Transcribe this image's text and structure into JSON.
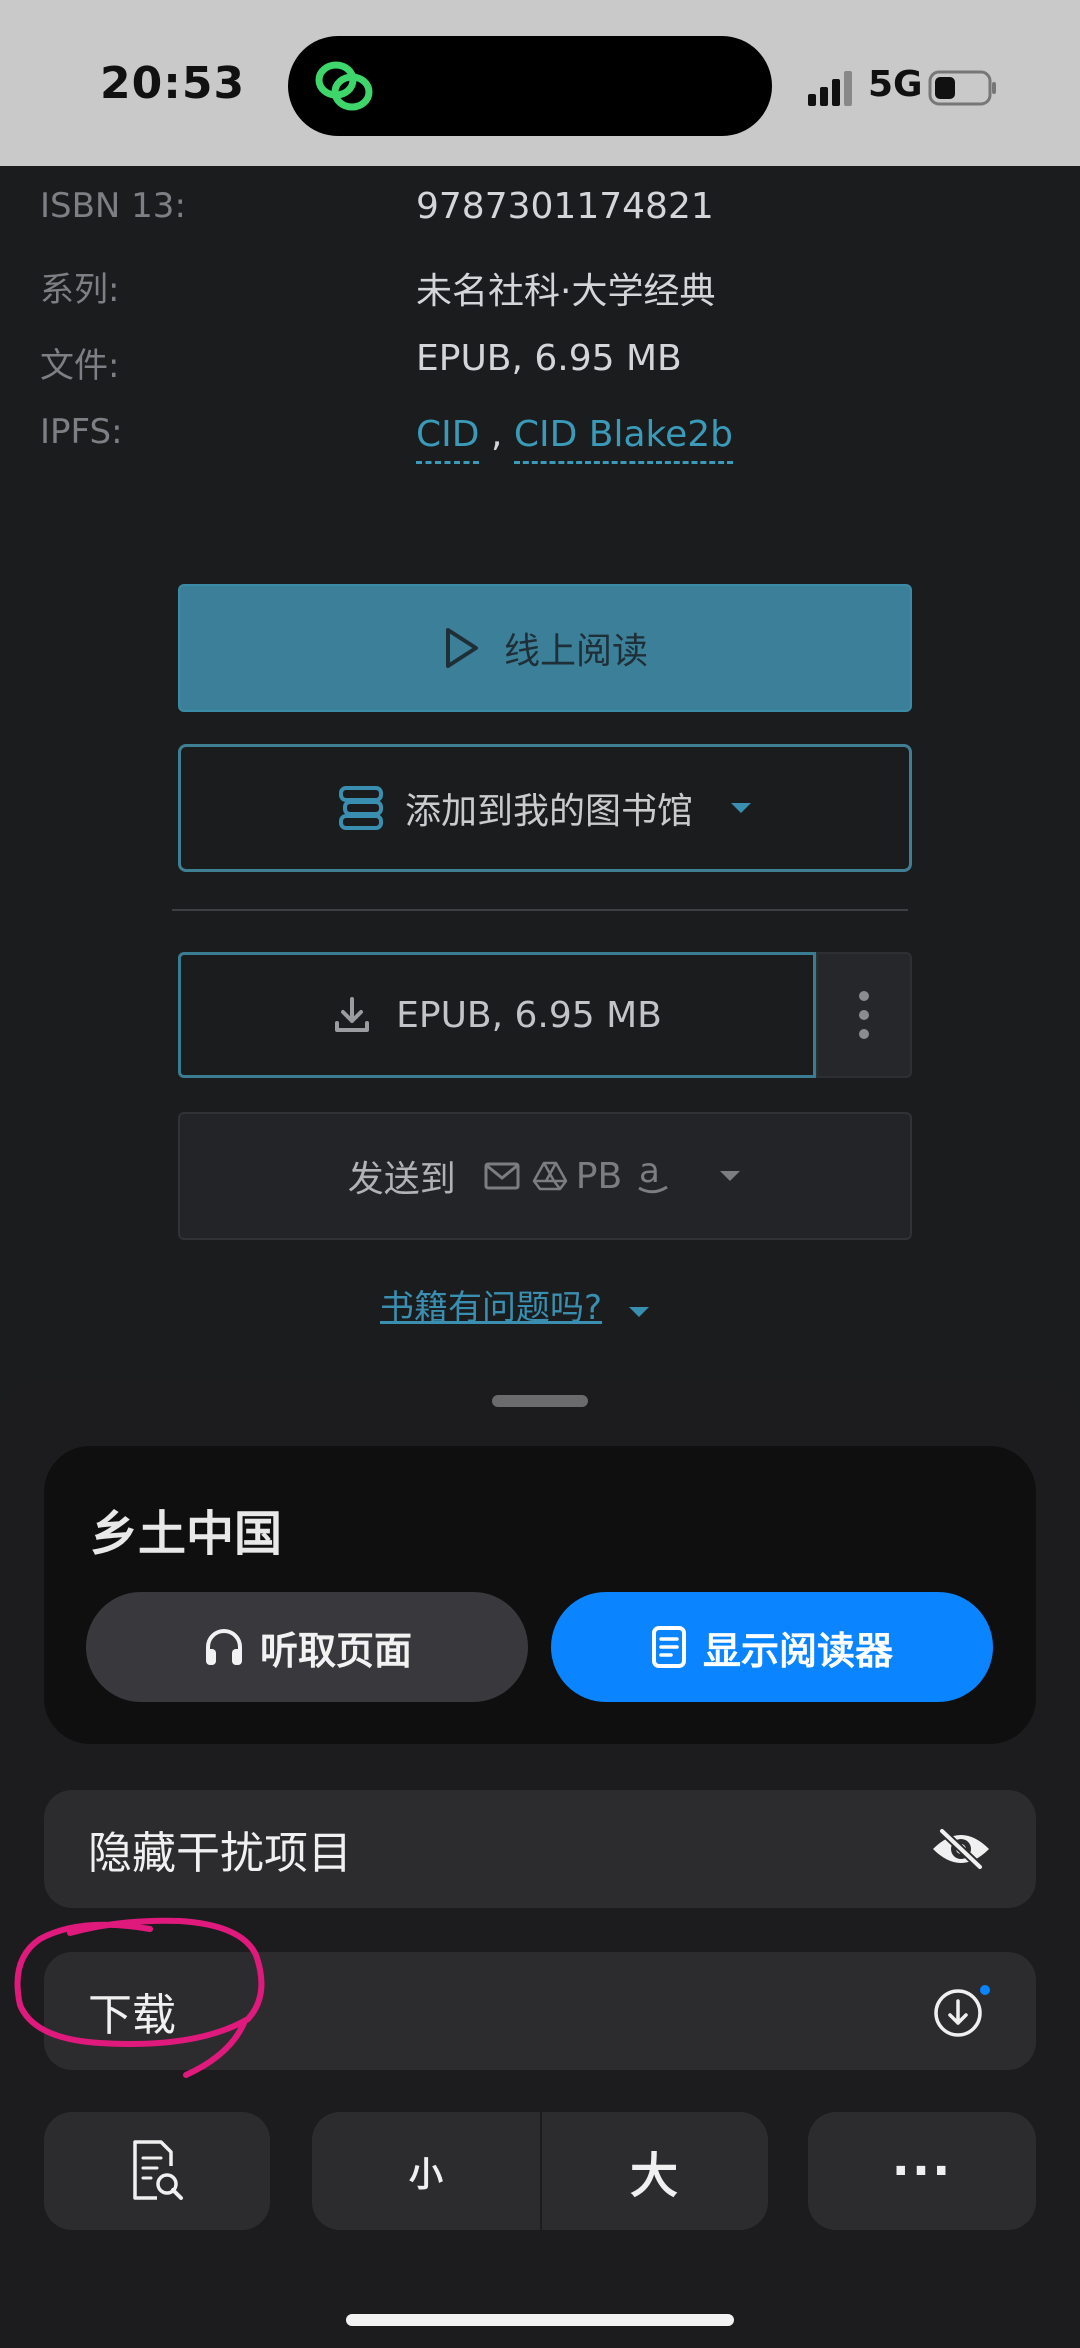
{
  "status_bar": {
    "time": "20:53",
    "network": "5G"
  },
  "metadata": [
    {
      "label": "ISBN 13:",
      "value": "9787301174821"
    },
    {
      "label": "系列:",
      "value": "未名社科·大学经典"
    },
    {
      "label": "文件:",
      "value": "EPUB, 6.95 MB"
    },
    {
      "label": "IPFS:",
      "link1": "CID",
      "sep": ",",
      "link2": "CID Blake2b"
    }
  ],
  "buttons": {
    "read_online": "线上阅读",
    "add_library": "添加到我的图书馆",
    "download": "EPUB, 6.95 MB",
    "send_to": "发送到",
    "send_pb": "PB",
    "problem": "书籍有问题吗?"
  },
  "sheet": {
    "title": "乡土中国",
    "listen": "听取页面",
    "reader": "显示阅读器",
    "hide_distractions": "隐藏干扰项目",
    "download": "下载",
    "font_small": "小",
    "font_large": "大",
    "more": "···"
  },
  "colors": {
    "accent": "#0a84ff",
    "link": "#3a9ab8",
    "annotation": "#e0197d"
  }
}
